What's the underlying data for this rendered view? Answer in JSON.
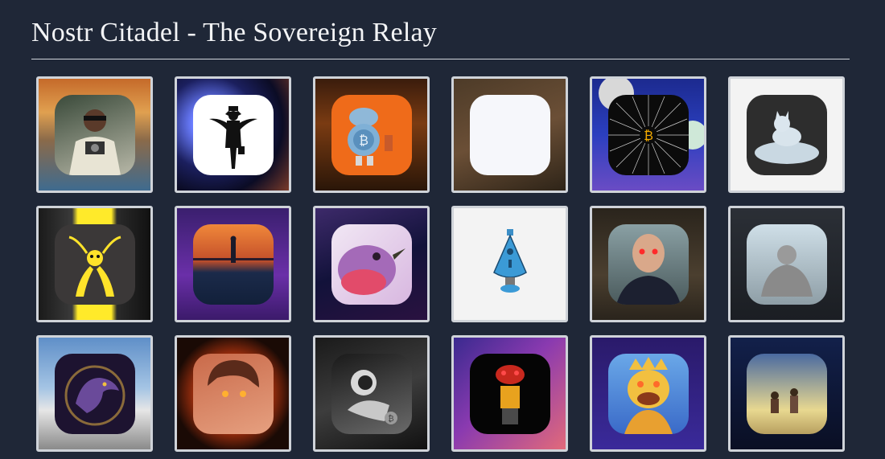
{
  "page": {
    "title": "Nostr Citadel - The Sovereign Relay"
  },
  "profiles": [
    {
      "name": "profile-1",
      "bg": "linear-gradient(180deg,#c56a2a 0%,#e0a050 30%,#8a6a4a 55%,#3f6b8f 100%)",
      "fg": "linear-gradient(160deg,#3a4a3a,#b8b8a8)"
    },
    {
      "name": "profile-2",
      "bg": "radial-gradient(circle at 30% 40%,#ffffff 0%,#6a7dff 18%,#1b1f5e 45%,#0b0c25 70%,#7a3b2a 100%)",
      "fg": "#ffffff"
    },
    {
      "name": "profile-3",
      "bg": "linear-gradient(180deg,#3a1c0c 0%,#7a3b12 40%,#2a1608 100%)",
      "fg": "#ef6b1a"
    },
    {
      "name": "profile-4",
      "bg": "linear-gradient(160deg,#4d3b28,#6b4f36 50%,#2e2418)",
      "fg": "#f6f7fb"
    },
    {
      "name": "profile-5",
      "bg": "linear-gradient(180deg,#1c2a8f 0%,#2b3fbf 50%,#6a4cc4 100%)",
      "fg": "#0b0b0b"
    },
    {
      "name": "profile-6",
      "bg": "#f3f3f3",
      "fg": "#2d2d2d"
    },
    {
      "name": "profile-7",
      "bg": "linear-gradient(90deg,#1a1a1a,#3a3a3a 30%,#ffea2a 35%,#ffea2a 65%,#2a2a2a 70%,#111)",
      "fg": "#3b3838"
    },
    {
      "name": "profile-8",
      "bg": "linear-gradient(180deg,#3a1f6e,#6a2fa8 60%,#3b1a6a)",
      "fg": "linear-gradient(180deg,#f0883a 0%,#c44f2a 45%,#1b2a4a 60%,#12203a 100%)"
    },
    {
      "name": "profile-9",
      "bg": "linear-gradient(160deg,#3d2a6a,#12123a 50%,#2a1240)",
      "fg": "linear-gradient(135deg,#f1e7f4,#d8b7e0)"
    },
    {
      "name": "profile-10",
      "bg": "#f3f3f3",
      "fg": "#f3f3f3"
    },
    {
      "name": "profile-11",
      "bg": "linear-gradient(180deg,#2a241c,#4b3f2f 60%,#2a241c)",
      "fg": "linear-gradient(180deg,#8aa0a4,#4a5a5c)"
    },
    {
      "name": "profile-12",
      "bg": "linear-gradient(180deg,#2b2f36,#1b1e23)",
      "fg": "linear-gradient(180deg,#cfdfe8,#8e9ea6)"
    },
    {
      "name": "profile-13",
      "bg": "linear-gradient(180deg,#5f8fc8,#a4c4e4 45%,#e6e6e6 65%,#8a8a8a)",
      "fg": "#1d1330"
    },
    {
      "name": "profile-14",
      "bg": "radial-gradient(circle,#f04f1a 0%,#c83a10 40%,#1a0a05 75%)",
      "fg": "linear-gradient(160deg,#c96a4a,#e6a080)"
    },
    {
      "name": "profile-15",
      "bg": "linear-gradient(160deg,#1a1a1a,#3d3d3d 50%,#111)",
      "fg": "linear-gradient(160deg,#1a1a1a,#6a6a6a)"
    },
    {
      "name": "profile-16",
      "bg": "linear-gradient(135deg,#3a2a8f,#8a3ab0 45%,#e26a7a 100%)",
      "fg": "#050505"
    },
    {
      "name": "profile-17",
      "bg": "linear-gradient(180deg,#2a1a6a,#3a2a9a)",
      "fg": "linear-gradient(180deg,#6aa8e8,#3a6ac8)"
    },
    {
      "name": "profile-18",
      "bg": "linear-gradient(180deg,#12204a,#0a0f24)",
      "fg": "linear-gradient(180deg,#4a6aa0,#e8d890 70%,#b8a060)"
    }
  ]
}
